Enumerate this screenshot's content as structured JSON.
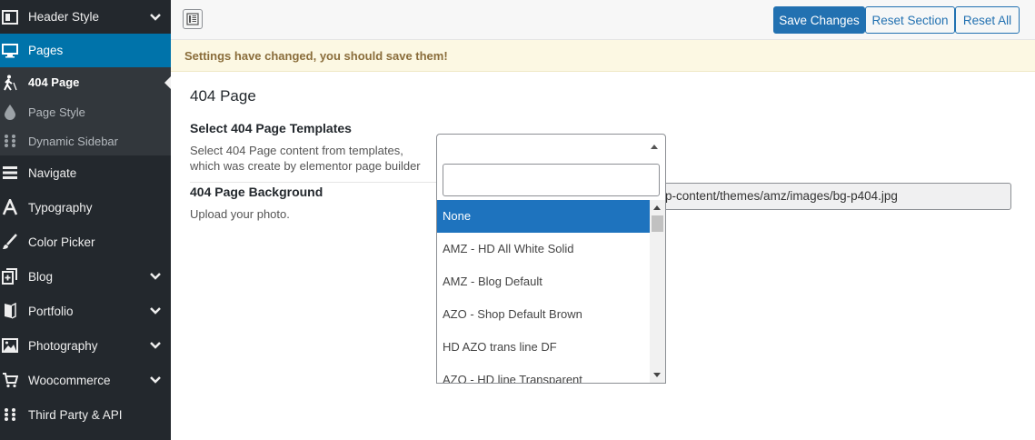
{
  "sidebar": {
    "items": [
      {
        "label": "Header Style",
        "icon": "layout-icon"
      },
      {
        "label": "Pages",
        "icon": "monitor-icon"
      },
      {
        "label": "404 Page",
        "icon": "walking-icon"
      },
      {
        "label": "Page Style",
        "icon": "drop-icon"
      },
      {
        "label": "Dynamic Sidebar",
        "icon": "grid-dots-icon"
      },
      {
        "label": "Navigate",
        "icon": "bars-icon"
      },
      {
        "label": "Typography",
        "icon": "font-icon"
      },
      {
        "label": "Color Picker",
        "icon": "brush-icon"
      },
      {
        "label": "Blog",
        "icon": "copy-plus-icon"
      },
      {
        "label": "Portfolio",
        "icon": "book-icon"
      },
      {
        "label": "Photography",
        "icon": "image-icon"
      },
      {
        "label": "Woocommerce",
        "icon": "cart-icon"
      },
      {
        "label": "Third Party & API",
        "icon": "grid-dots-icon"
      }
    ]
  },
  "toolbar": {
    "save_label": "Save Changes",
    "reset_section_label": "Reset Section",
    "reset_all_label": "Reset All"
  },
  "notice": {
    "text": "Settings have changed, you should save them!"
  },
  "main": {
    "title": "404 Page",
    "templates": {
      "title": "Select 404 Page Templates",
      "desc_line1": "Select 404 Page content from templates,",
      "desc_line2": "which was create by elementor page builder",
      "selected": "",
      "search_value": "",
      "options": [
        "None",
        "AMZ - HD All White Solid",
        "AMZ - Blog Default",
        "AZO - Shop Default Brown",
        "HD AZO trans line DF",
        "AZO - HD line Transparent"
      ],
      "highlighted": "None"
    },
    "background": {
      "title": "404 Page Background",
      "desc": "Upload your photo.",
      "value": "p-content/themes/amz/images/bg-p404.jpg"
    }
  },
  "colors": {
    "sidebar_bg": "#23282d",
    "active_bg": "#0073aa",
    "primary": "#2271b1",
    "notice_bg": "#fcf8e3",
    "notice_text": "#8a6d3b",
    "option_highlight": "#1e73be"
  }
}
